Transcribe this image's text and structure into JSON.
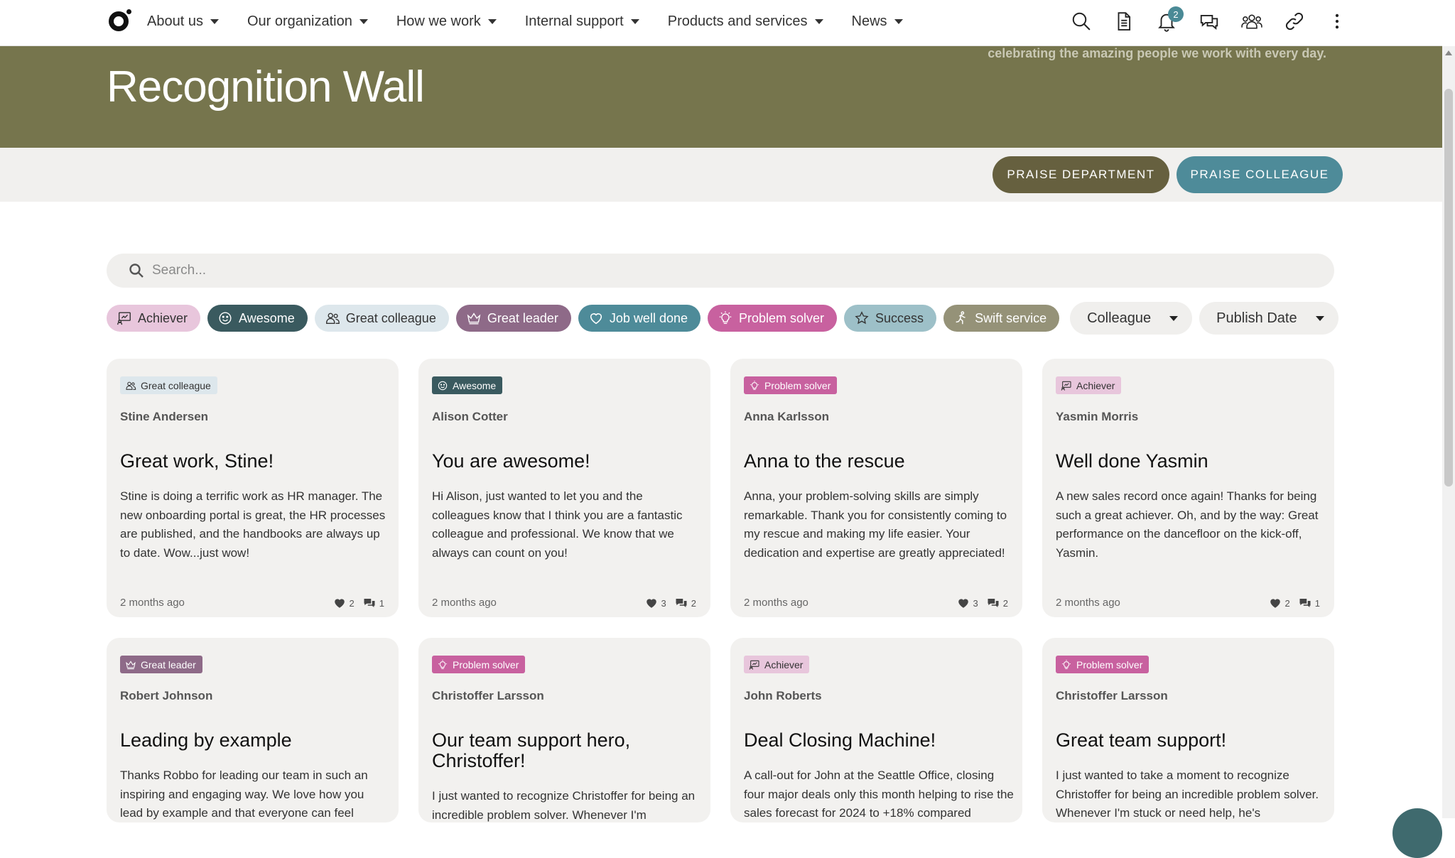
{
  "nav": {
    "items": [
      {
        "label": "About us"
      },
      {
        "label": "Our organization"
      },
      {
        "label": "How we work"
      },
      {
        "label": "Internal support"
      },
      {
        "label": "Products and services"
      },
      {
        "label": "News"
      }
    ],
    "notification_count": "2",
    "icons": [
      "search-icon",
      "document-icon",
      "bell-icon",
      "chat-icon",
      "people-icon",
      "link-icon",
      "more-vertical-icon"
    ]
  },
  "hero": {
    "tagline": "celebrating the amazing people we work with every day.",
    "title": "Recognition Wall"
  },
  "actions": {
    "praise_department": "PRAISE DEPARTMENT",
    "praise_colleague": "PRAISE COLLEAGUE"
  },
  "search": {
    "placeholder": "Search..."
  },
  "colors": {
    "hero_bg": "#76754d",
    "accent_teal": "#4e8b99",
    "accent_olive": "#66603f"
  },
  "filters": {
    "chips": [
      {
        "label": "Achiever",
        "icon": "achiever-icon"
      },
      {
        "label": "Awesome",
        "icon": "smiley-icon"
      },
      {
        "label": "Great colleague",
        "icon": "people-icon"
      },
      {
        "label": "Great leader",
        "icon": "crown-icon"
      },
      {
        "label": "Job well done",
        "icon": "heart-icon"
      },
      {
        "label": "Problem solver",
        "icon": "lightbulb-icon"
      },
      {
        "label": "Success",
        "icon": "star-icon"
      },
      {
        "label": "Swift service",
        "icon": "running-icon"
      }
    ],
    "colleague_select": "Colleague",
    "date_select": "Publish Date"
  },
  "cards": [
    {
      "tag": "Great colleague",
      "author": "Stine Andersen",
      "title": "Great work, Stine!",
      "body": "Stine is doing a terrific work as HR manager. The new onboarding portal is great, the HR processes are published, and the handbooks are always up to date. Wow...just wow!",
      "date": "2 months ago",
      "likes": "2",
      "comments": "1"
    },
    {
      "tag": "Awesome",
      "author": "Alison Cotter",
      "title": "You are awesome!",
      "body": "Hi Alison, just wanted to let you and the colleagues know that I think you are a fantastic colleague and professional. We know that we always can count on you!",
      "date": "2 months ago",
      "likes": "3",
      "comments": "2"
    },
    {
      "tag": "Problem solver",
      "author": "Anna Karlsson",
      "title": "Anna to the rescue",
      "body": "Anna, your problem-solving skills are simply remarkable. Thank you for consistently coming to my rescue and making my life easier. Your dedication and expertise are greatly appreciated!",
      "date": "2 months ago",
      "likes": "3",
      "comments": "2"
    },
    {
      "tag": "Achiever",
      "author": "Yasmin Morris",
      "title": "Well done Yasmin",
      "body": "A new sales record once again! Thanks for being such a great achiever. Oh, and by the way: Great performance on the dancefloor on the kick-off, Yasmin.",
      "date": "2 months ago",
      "likes": "2",
      "comments": "1"
    },
    {
      "tag": "Great leader",
      "author": "Robert Johnson",
      "title": "Leading by example",
      "body": "Thanks Robbo for leading our team in such an inspiring and engaging way. We love how you lead by example and that everyone can feel"
    },
    {
      "tag": "Problem solver",
      "author": "Christoffer Larsson",
      "title": "Our team support hero, Christoffer!",
      "body": "I just wanted to recognize Christoffer for being an incredible problem solver. Whenever I'm"
    },
    {
      "tag": "Achiever",
      "author": "John Roberts",
      "title": "Deal Closing Machine!",
      "body": "A call-out for John at the Seattle Office, closing four major deals only this month helping to rise the sales forecast for 2024 to +18% compared"
    },
    {
      "tag": "Problem solver",
      "author": "Christoffer Larsson",
      "title": "Great team support!",
      "body": "I just wanted to take a moment to recognize Christoffer for being an incredible problem solver. Whenever I'm stuck or need help, he's"
    }
  ]
}
